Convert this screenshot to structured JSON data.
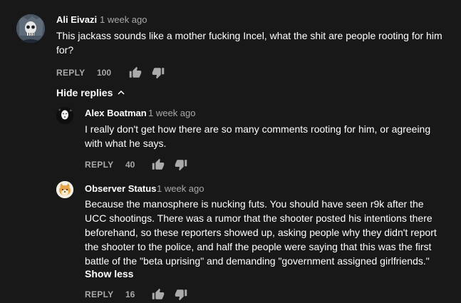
{
  "comments": [
    {
      "author": "Ali Eivazi",
      "time": "1 week ago",
      "text_lines": [
        "This jackass sounds like a mother fucking Incel, what the shit are people rooting for him",
        "for?"
      ],
      "reply_label": "REPLY",
      "likes": "100",
      "avatar_icon": "skull-avatar"
    }
  ],
  "hide_replies_label": "Hide replies",
  "replies": [
    {
      "author": "Alex Boatman",
      "time": "1 week ago",
      "text_lines": [
        "I really don't get how there are so many comments rooting for him, or agreeing",
        "with what he says."
      ],
      "reply_label": "REPLY",
      "likes": "40",
      "avatar_icon": "no-face-avatar"
    },
    {
      "author": "Observer Status",
      "time": "1 week ago",
      "text_lines": [
        "Because the manosphere is nucking futs. You should have seen r9k after the",
        "UCC shootings. There was a rumor that the shooter posted his intentions there",
        "beforehand, so these reporters showed up, asking people why they didn't report",
        "the shooter to the police, and half the people were saying that this was the first",
        "battle of the \"beta uprising\" and demanding \"government assigned girlfriends.\""
      ],
      "show_less_label": "Show less",
      "reply_label": "REPLY",
      "likes": "16",
      "avatar_icon": "shiba-avatar"
    }
  ],
  "colors": {
    "background": "#181818",
    "secondary_text": "#aaaaaa"
  }
}
